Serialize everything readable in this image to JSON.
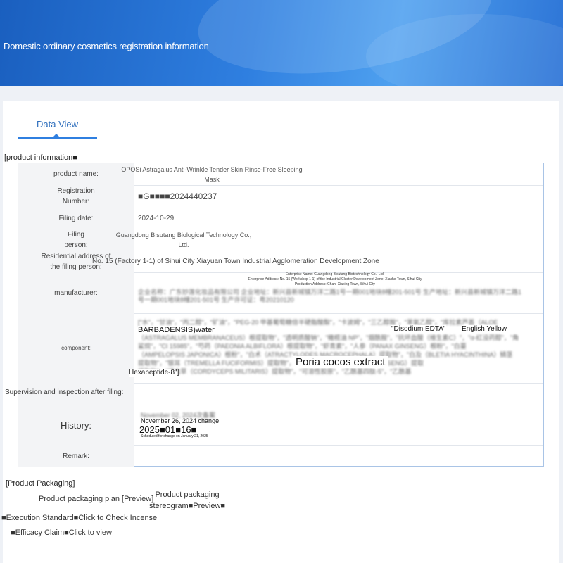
{
  "banner": {
    "title": "Domestic ordinary cosmetics registration information"
  },
  "tab": {
    "label": "Data View"
  },
  "product_information": {
    "header": "[product information■"
  },
  "rows": {
    "product_name": {
      "label": "product name:",
      "value_line1": "OPOSi Astragalus Anti-Wrinkle Tender Skin Rinse-Free Sleeping",
      "value_line2": "Mask"
    },
    "registration": {
      "label_line1": "Registration",
      "label_line2": "Number:",
      "value": "■G■■■■2024440237"
    },
    "filing_date": {
      "label": "Filing date:",
      "value": "2024-10-29"
    },
    "filing_person": {
      "label_line1": "Filing",
      "label_line2": "person:",
      "value_line1": "Guangdong Bisutang Biological Technology Co.,",
      "value_line2": "Ltd."
    },
    "address": {
      "label_line1": "Residential address of",
      "label_line2": "the filing person:",
      "value": "No. 15 (Factory 1-1) of Sihui City Xiayuan Town Industrial Agglomeration Development Zone"
    },
    "manufacturer": {
      "label": "manufacturer:",
      "en_line1": "Enterprise Name: Guangdong Bisutang Biotechnology Co., Ltd.",
      "en_line2": "Enterprise Address: No. 15 (Workshop 1-1) of the Industrial Cluster Development Zone, Xiaxhe Town, Sihui City",
      "en_line3": "Production Address: Chan, Xiaxing Town, Sihui City",
      "cn_line1": "企业名称：广东妙莲化妆品有限公司 企业地址：新兴县新城镇万洋二路1号一期001地块8幢201-501号 生产地址：新兴县新城镇万洋二路1",
      "cn_line2": "号一期001地块8幢201-501号 生产许可证：粤20210120"
    },
    "component": {
      "label": "component:",
      "overlay_water": "BARBADENSIS)water",
      "overlay_edta": "\"Disodium EDTA\"",
      "overlay_yellow": "English Yellow",
      "overlay_poria": "Poria cocos extract",
      "overlay_hexa": "Hexapeptide-8\"]",
      "cn_line1": "[\"水\"，\"甘油\"，\"丙二醇\"，\"矿油\"，\"PEG-20 甲基葡萄糖倍半硬脂酸酯\"，\"卡波姆\"，\"三乙醇胺\"，\"苯氧乙醇\"，\"库拉素芦荟（ALOE",
      "cn_line2": "（ASTRAGALUS MEMBRANACEUS）根提取物\"，\"透明质酸钠\"，\"橄榄油 NP\"，\"烟酰胺\"，\"抗坏血酸（维生素C）\"，\"α-红没药醇\"，\"角",
      "cn_line3": "鲨烷\"，\"CI 15985\"，\"芍药（PAEONIA ALBIFLORA）根提取物\"，\"虾青素\"，\"人参（PANAX GINSENG）根粉\"，\"白蔓",
      "cn_line4": "（AMPELOPSIS JAPONICA）根粉\"，\"白术（ATRACTYLODES MACROCEPHALA）提取物\"，\"白及（BLETIA HYACINTHINA）鳞茎",
      "cn_line5": "提取物\"，\"银耳（TREMELLA FUCIFORMIS）提取物\"，\"CI 19140\"，\"人参（PANAX GINSENG）提取",
      "cn_line6": "提取物\"，\"蛹虫草（CORDYCEPS MILITARIS）提取物\"，\"可溶性胶原\"，\"乙酰基四肽-5\"，\"乙酰基"
    },
    "supervision": {
      "label": "Supervision and inspection after filing:"
    },
    "history": {
      "label": "History:",
      "line1": "November 02, 2024次备案",
      "line2": "November 26, 2024 change",
      "line3": "2025■01■16■",
      "line4": "Scheduled for change on January 21, 2025"
    },
    "remark": {
      "label": "Remark:"
    }
  },
  "packaging": {
    "header": "[Product Packaging]",
    "plan": "Product packaging plan [Preview]",
    "stereogram_line1": "Product packaging",
    "stereogram_line2": "stereogram■Preview■"
  },
  "execution_standard": "■Execution Standard■Click to Check Incense",
  "efficacy_claim": "■Efficacy Claim■Click to view"
}
